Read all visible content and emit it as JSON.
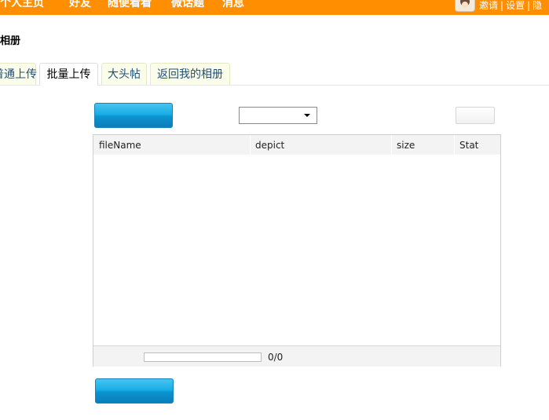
{
  "topbar": {
    "nav": [
      "个人主页",
      "好友",
      "随便看看",
      "微话题",
      "消息"
    ],
    "links": [
      "邀请",
      "设置",
      "隐"
    ]
  },
  "page": {
    "title": "相册"
  },
  "tabs": [
    {
      "label": "普通上传",
      "active": false
    },
    {
      "label": "批量上传",
      "active": true
    },
    {
      "label": "大头帖",
      "active": false
    },
    {
      "label": "返回我的相册",
      "active": false
    }
  ],
  "uploader": {
    "select_value": "",
    "columns": [
      "fileName",
      "depict",
      "size",
      "Stat"
    ],
    "files": [],
    "progress": 0,
    "count": "0/0"
  }
}
